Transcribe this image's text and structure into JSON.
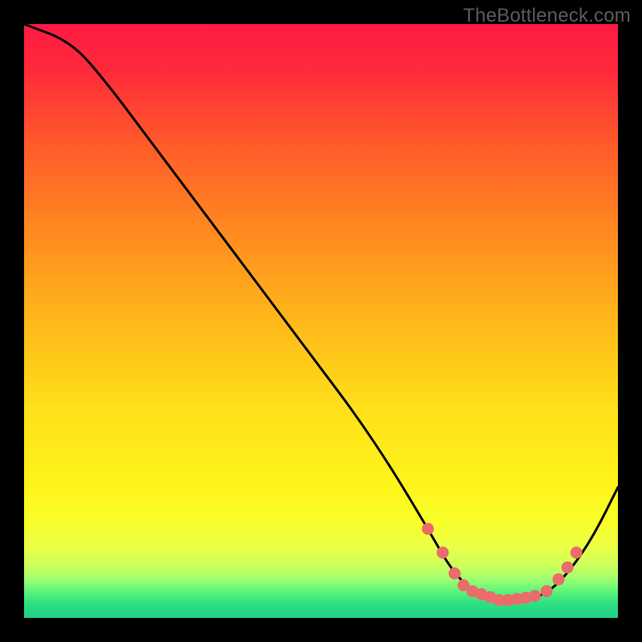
{
  "watermark": "TheBottleneck.com",
  "chart_data": {
    "type": "line",
    "title": "",
    "xlabel": "",
    "ylabel": "",
    "xlim": [
      0,
      100
    ],
    "ylim": [
      0,
      100
    ],
    "series": [
      {
        "name": "curve",
        "x": [
          0,
          8,
          14,
          20,
          26,
          32,
          38,
          44,
          50,
          56,
          62,
          68,
          72,
          76,
          80,
          84,
          88,
          92,
          96,
          100
        ],
        "y": [
          100,
          97,
          90,
          82,
          74,
          66,
          58,
          50,
          42,
          34,
          25,
          15,
          8,
          4,
          3,
          3,
          4,
          8,
          14,
          22
        ]
      }
    ],
    "marker_points": {
      "x": [
        68,
        70.5,
        72.5,
        74,
        75.5,
        77,
        78.5,
        80,
        81.5,
        83,
        84.5,
        86,
        88,
        90,
        91.5,
        93
      ],
      "y": [
        15,
        11,
        7.5,
        5.5,
        4.5,
        4,
        3.5,
        3,
        3,
        3.2,
        3.4,
        3.7,
        4.5,
        6.5,
        8.5,
        11
      ]
    },
    "gradient_stops": [
      {
        "offset": 0.0,
        "color": "#ff1a44"
      },
      {
        "offset": 0.08,
        "color": "#ff2a3a"
      },
      {
        "offset": 0.2,
        "color": "#ff5a2a"
      },
      {
        "offset": 0.35,
        "color": "#ff8a1f"
      },
      {
        "offset": 0.5,
        "color": "#ffb81a"
      },
      {
        "offset": 0.65,
        "color": "#ffe01a"
      },
      {
        "offset": 0.78,
        "color": "#fff51a"
      },
      {
        "offset": 0.84,
        "color": "#f8ff2a"
      },
      {
        "offset": 0.885,
        "color": "#e8ff4a"
      },
      {
        "offset": 0.915,
        "color": "#c8ff5f"
      },
      {
        "offset": 0.935,
        "color": "#9cff70"
      },
      {
        "offset": 0.955,
        "color": "#5cf57a"
      },
      {
        "offset": 0.975,
        "color": "#2fe082"
      },
      {
        "offset": 1.0,
        "color": "#1fd084"
      }
    ],
    "marker_color": "#ec6b6b",
    "curve_color": "#000000"
  }
}
